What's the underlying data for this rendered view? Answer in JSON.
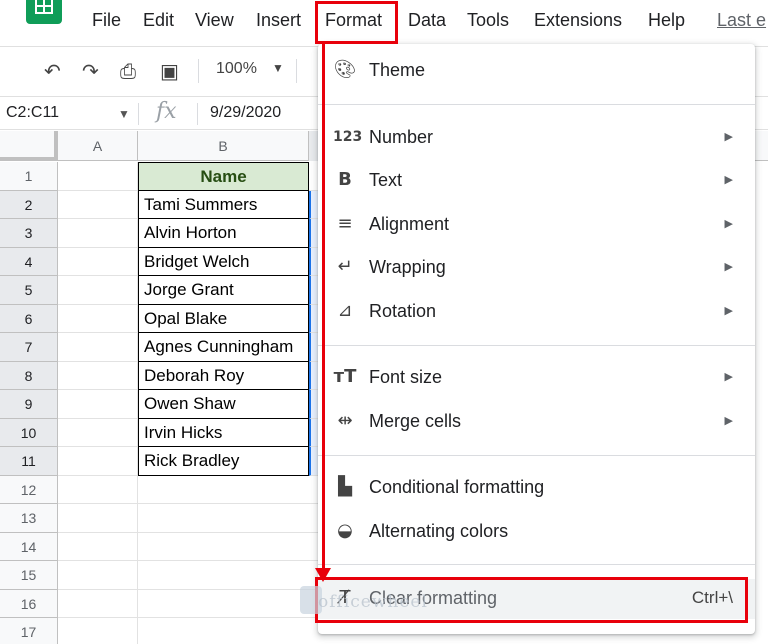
{
  "menubar": {
    "items": [
      "File",
      "Edit",
      "View",
      "Insert",
      "Format",
      "Data",
      "Tools",
      "Extensions",
      "Help"
    ],
    "last_edit": "Last e"
  },
  "toolbar": {
    "zoom": "100%",
    "icons": [
      "undo-icon",
      "redo-icon",
      "print-icon",
      "paint-format-icon"
    ]
  },
  "formula_bar": {
    "range": "C2:C11",
    "fx": "fx",
    "value": "9/29/2020"
  },
  "grid": {
    "columns": [
      "A",
      "B"
    ],
    "rows": [
      "1",
      "2",
      "3",
      "4",
      "5",
      "6",
      "7",
      "8",
      "9",
      "10",
      "11",
      "12",
      "13",
      "14",
      "15",
      "16",
      "17"
    ],
    "header": "Name",
    "names": [
      "Tami Summers",
      "Alvin Horton",
      "Bridget Welch",
      "Jorge Grant",
      "Opal Blake",
      "Agnes Cunningham",
      "Deborah Roy",
      "Owen Shaw",
      "Irvin Hicks",
      "Rick Bradley"
    ]
  },
  "format_menu": {
    "theme": "Theme",
    "number": "Number",
    "text": "Text",
    "alignment": "Alignment",
    "wrapping": "Wrapping",
    "rotation": "Rotation",
    "font_size": "Font size",
    "merge_cells": "Merge cells",
    "conditional_formatting": "Conditional formatting",
    "alternating_colors": "Alternating colors",
    "clear_formatting": "Clear formatting",
    "clear_shortcut": "Ctrl+\\"
  },
  "watermark": "officewheel",
  "colors": {
    "annotation": "#e8000b",
    "header_fill": "#d9ead3",
    "selection": "#1a73e8"
  }
}
